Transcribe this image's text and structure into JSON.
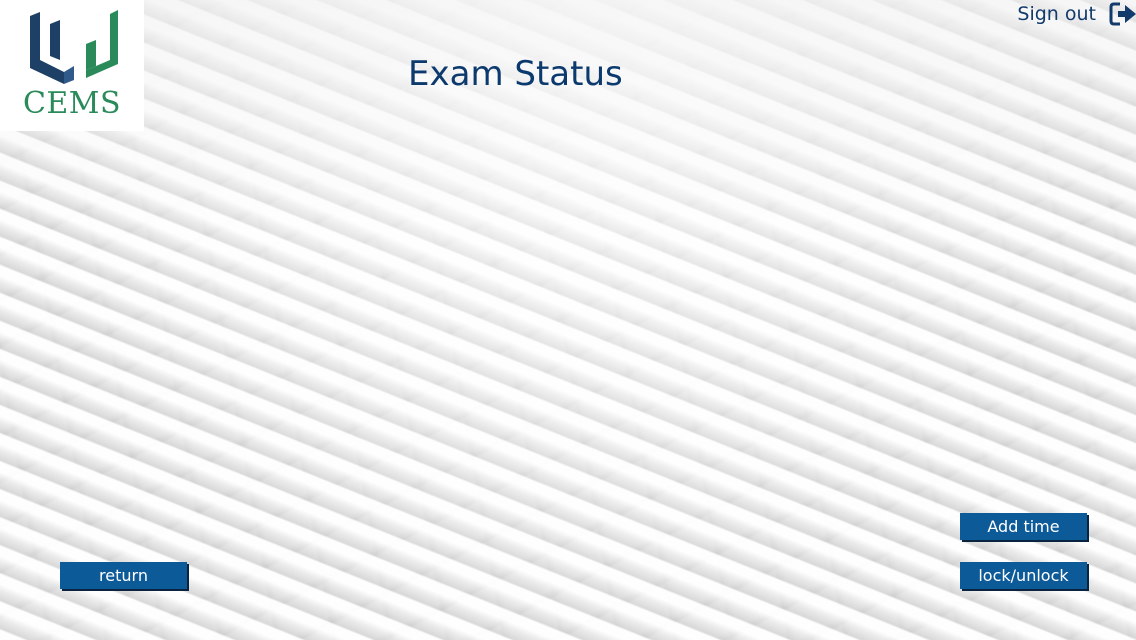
{
  "app": {
    "logo_text": "CEMS",
    "logo_icon": "cems-logo-icon"
  },
  "header": {
    "title": "Exam Status",
    "signout_label": "Sign out",
    "signout_icon": "sign-out-icon"
  },
  "actions": {
    "return_label": "return",
    "add_time_label": "Add time",
    "lock_unlock_label": "lock/unlock"
  },
  "colors": {
    "primary_button": "#0d5a99",
    "title_text": "#0c3a6e",
    "logo_green": "#2a8a5a",
    "logo_navy": "#1e3f66"
  }
}
